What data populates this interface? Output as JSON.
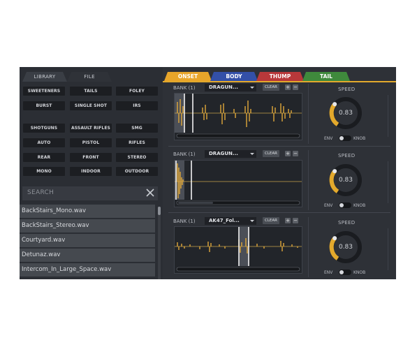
{
  "left_tabs": [
    "LIBRARY",
    "FILE"
  ],
  "tag_groups": [
    [
      "SWEETENERS",
      "TAILS",
      "FOLEY",
      "BURST",
      "SINGLE SHOT",
      "IRS"
    ],
    [
      "SHOTGUNS",
      "ASSAULT RIFLES",
      "SMG",
      "AUTO",
      "PISTOL",
      "RIFLES",
      "REAR",
      "FRONT",
      "STEREO",
      "MONO",
      "INDOOR",
      "OUTDOOR"
    ]
  ],
  "search": {
    "placeholder": "SEARCH",
    "clear_icon": "close-icon"
  },
  "files": [
    "BackStairs_Mono.wav",
    "BackStairs_Stereo.wav",
    "Courtyard.wav",
    "Detunaz.wav",
    "Intercom_In_Large_Space.wav"
  ],
  "layer_tabs": [
    {
      "label": "ONSET",
      "color": "#e8a52a"
    },
    {
      "label": "BODY",
      "color": "#3350a8"
    },
    {
      "label": "THUMP",
      "color": "#b8383a"
    },
    {
      "label": "TAIL",
      "color": "#3f8a3c"
    }
  ],
  "rows": [
    {
      "bank_label": "BANK (1)",
      "sample": "DRAGUN...",
      "clear": "CLEAR",
      "add": "+",
      "remove": "−",
      "speed_label": "SPEED",
      "speed_value": "0.83",
      "speed_level": 0.62,
      "env_label": "ENV",
      "knob_label": "KNOB"
    },
    {
      "bank_label": "BANK (1)",
      "sample": "DRAGUN...",
      "clear": "CLEAR",
      "add": "+",
      "remove": "−",
      "speed_label": "SPEED",
      "speed_value": "0.83",
      "speed_level": 0.62,
      "env_label": "ENV",
      "knob_label": "KNOB"
    },
    {
      "bank_label": "BANK (1)",
      "sample": "AK47_Fol...",
      "clear": "CLEAR",
      "add": "+",
      "remove": "−",
      "speed_label": "SPEED",
      "speed_value": "0.83",
      "speed_level": 0.62,
      "env_label": "ENV",
      "knob_label": "KNOB"
    }
  ],
  "colors": {
    "accent": "#e3a92c",
    "waveform": "#e0a83a",
    "panel": "#2a2d33"
  }
}
